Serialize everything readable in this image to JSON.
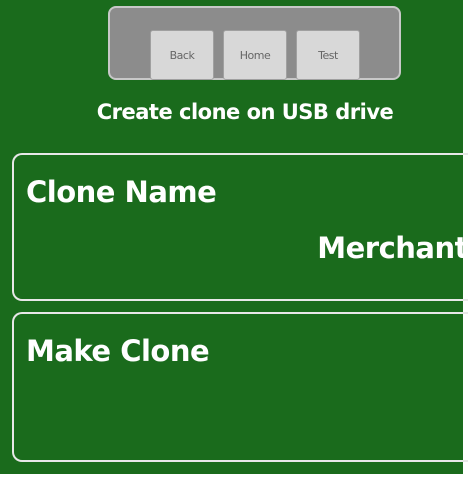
{
  "nav": {
    "back_label": "Back",
    "home_label": "Home",
    "test_label": "Test"
  },
  "header": {
    "subtitle": "Create clone on USB drive"
  },
  "clone_name": {
    "label": "Clone Name",
    "value": "Merchant"
  },
  "make_clone": {
    "label": "Make Clone"
  },
  "colors": {
    "background": "#1a6b1c",
    "nav_bar": "#8c8c8c",
    "button": "#d8d8d8",
    "text": "#ffffff"
  }
}
